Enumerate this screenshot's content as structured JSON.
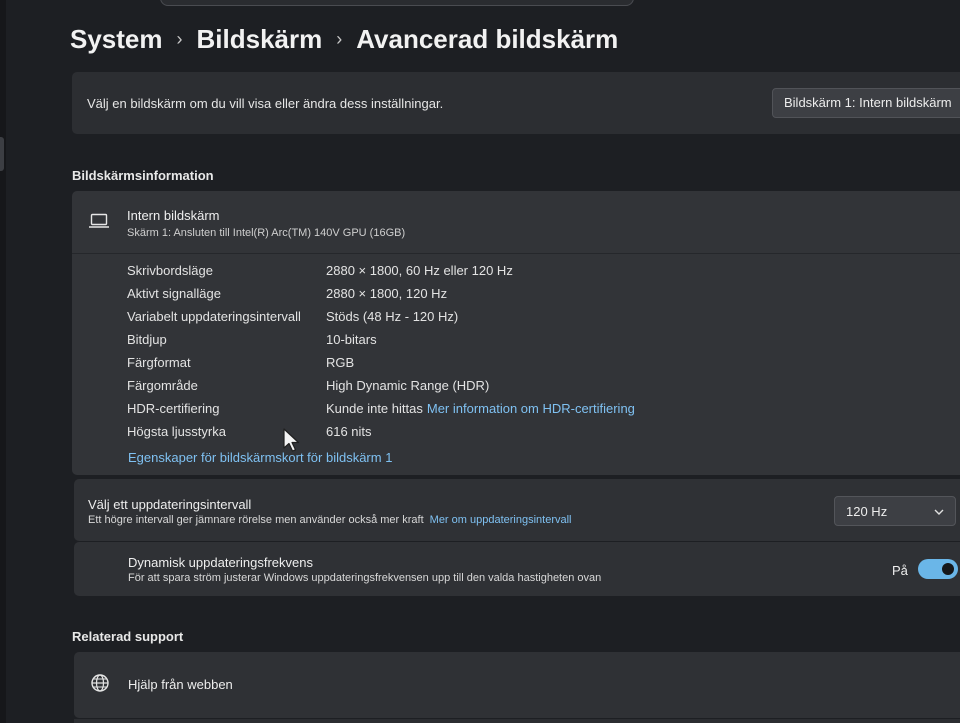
{
  "breadcrumb": {
    "root": "System",
    "parent": "Bildskärm",
    "current": "Avancerad bildskärm"
  },
  "select_display": {
    "description": "Välj en bildskärm om du vill visa eller ändra dess inställningar.",
    "selected": "Bildskärm 1: Intern bildskärm"
  },
  "display_info": {
    "section_title": "Bildskärmsinformation",
    "monitor_name": "Intern bildskärm",
    "monitor_subtitle": "Skärm 1: Ansluten till Intel(R) Arc(TM) 140V GPU (16GB)",
    "rows": [
      {
        "label": "Skrivbordsläge",
        "value": "2880 × 1800, 60 Hz eller 120 Hz",
        "link": ""
      },
      {
        "label": "Aktivt signalläge",
        "value": "2880 × 1800, 120 Hz",
        "link": ""
      },
      {
        "label": "Variabelt uppdateringsintervall",
        "value": "Stöds (48 Hz - 120 Hz)",
        "link": ""
      },
      {
        "label": "Bitdjup",
        "value": "10-bitars",
        "link": ""
      },
      {
        "label": "Färgformat",
        "value": "RGB",
        "link": ""
      },
      {
        "label": "Färgområde",
        "value": "High Dynamic Range (HDR)",
        "link": ""
      },
      {
        "label": "HDR-certifiering",
        "value": "Kunde inte hittas",
        "link": "Mer information om HDR-certifiering"
      },
      {
        "label": "Högsta ljusstyrka",
        "value": "616 nits",
        "link": ""
      }
    ],
    "adapter_link": "Egenskaper för bildskärmskort för bildskärm 1"
  },
  "refresh_rate": {
    "title": "Välj ett uppdateringsintervall",
    "subtitle": "Ett högre intervall ger jämnare rörelse men använder också mer kraft",
    "link": "Mer om uppdateringsintervall",
    "selected": "120 Hz"
  },
  "dynamic_refresh": {
    "title": "Dynamisk uppdateringsfrekvens",
    "subtitle": "För att spara ström justerar Windows uppdateringsfrekvensen upp till den valda hastigheten ovan",
    "state_label": "På",
    "enabled": true
  },
  "related_support": {
    "section_title": "Relaterad support",
    "items": [
      {
        "label": "Hjälp från webben",
        "icon": "globe-icon"
      }
    ]
  },
  "colors": {
    "accent": "#6ab6e8",
    "link": "#7fc1f2",
    "card": "#2f3135",
    "background": "#1d1f23"
  },
  "icons": {
    "monitor": "laptop-icon",
    "dropdown": "chevron-down-icon",
    "separator": "chevron-right-icon"
  }
}
